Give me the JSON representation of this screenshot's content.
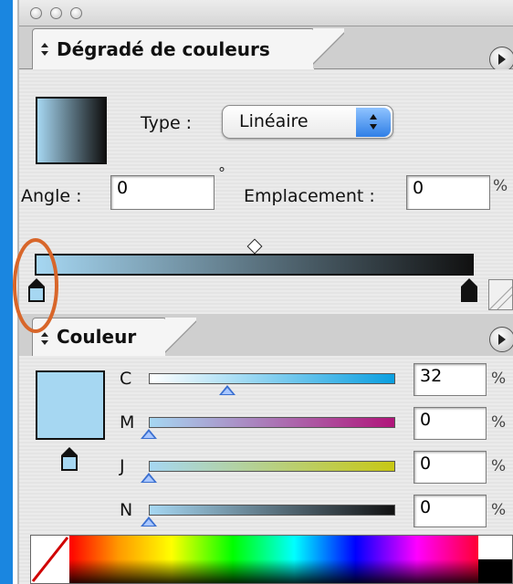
{
  "window": {
    "title_buttons": [
      "close",
      "minimize",
      "zoom"
    ]
  },
  "gradient_panel": {
    "tab_label": "Dégradé de couleurs",
    "type_label": "Type :",
    "type_value": "Linéaire",
    "angle_label": "Angle :",
    "angle_value": "0",
    "degree_symbol": "°",
    "location_label": "Emplacement :",
    "location_value": "0",
    "location_unit": "%",
    "start_color": "#a6d7f2",
    "end_color": "#111111",
    "midpoint_percent": 50
  },
  "color_panel": {
    "tab_label": "Couleur",
    "swatch_color": "#a6d7f2",
    "channels": [
      {
        "label": "C",
        "value": "32",
        "unit": "%",
        "slider_percent": 32,
        "track_from": "#ffffff",
        "track_to": "#0a9fe0"
      },
      {
        "label": "M",
        "value": "0",
        "unit": "%",
        "slider_percent": 0,
        "track_from": "#a6d7f2",
        "track_to": "#b0157a"
      },
      {
        "label": "J",
        "value": "0",
        "unit": "%",
        "slider_percent": 0,
        "track_from": "#a6d7f2",
        "track_to": "#c8c814"
      },
      {
        "label": "N",
        "value": "0",
        "unit": "%",
        "slider_percent": 0,
        "track_from": "#a6d7f2",
        "track_to": "#111111"
      }
    ]
  },
  "annotation": {
    "highlight_color": "#d8662a"
  }
}
